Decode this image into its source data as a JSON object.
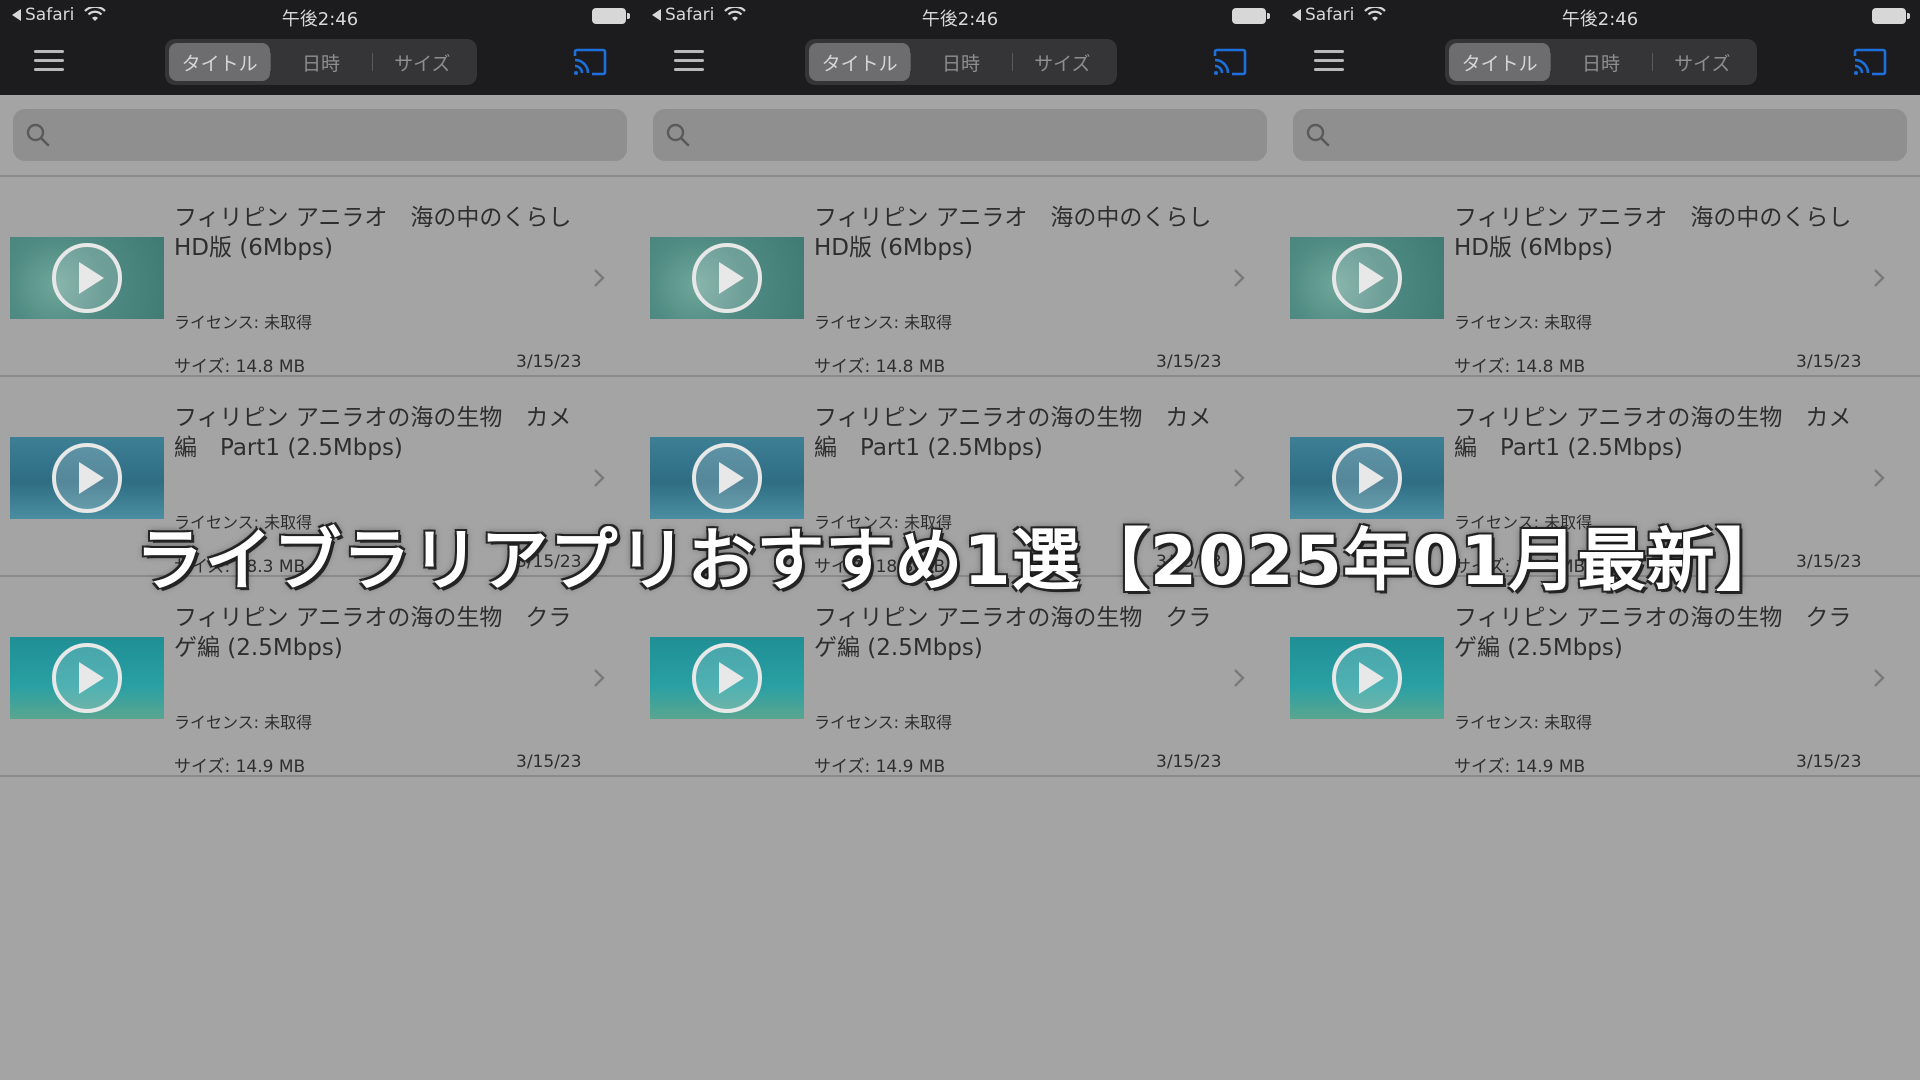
{
  "status_bar": {
    "back_app": "Safari",
    "time": "午後2:46"
  },
  "nav": {
    "segments": [
      "タイトル",
      "日時",
      "サイズ"
    ],
    "active_segment": "タイトル"
  },
  "search": {
    "placeholder": ""
  },
  "videos": [
    {
      "title": "フィリピン アニラオ　海の中のくらし　HD版 (6Mbps)",
      "license": "ライセンス: 未取得",
      "size": "サイズ: 14.8 MB",
      "date": "3/15/23"
    },
    {
      "title": "フィリピン アニラオの海の生物　カメ編　Part1 (2.5Mbps)",
      "license": "ライセンス: 未取得",
      "size": "サイズ: 18.3 MB",
      "date": "3/15/23"
    },
    {
      "title": "フィリピン アニラオの海の生物　クラゲ編 (2.5Mbps)",
      "license": "ライセンス: 未取得",
      "size": "サイズ: 14.9 MB",
      "date": "3/15/23"
    }
  ],
  "overlay": {
    "headline": "ライブラリアプリおすすめ1選【2025年01月最新】"
  },
  "colors": {
    "nav_background": "#1c1c1e",
    "cast_icon": "#1e6fd9",
    "page_background": "#a4a4a4"
  },
  "icons": [
    "wifi-icon",
    "battery-icon",
    "menu-icon",
    "cast-icon",
    "search-icon",
    "play-icon",
    "chevron-right-icon"
  ]
}
